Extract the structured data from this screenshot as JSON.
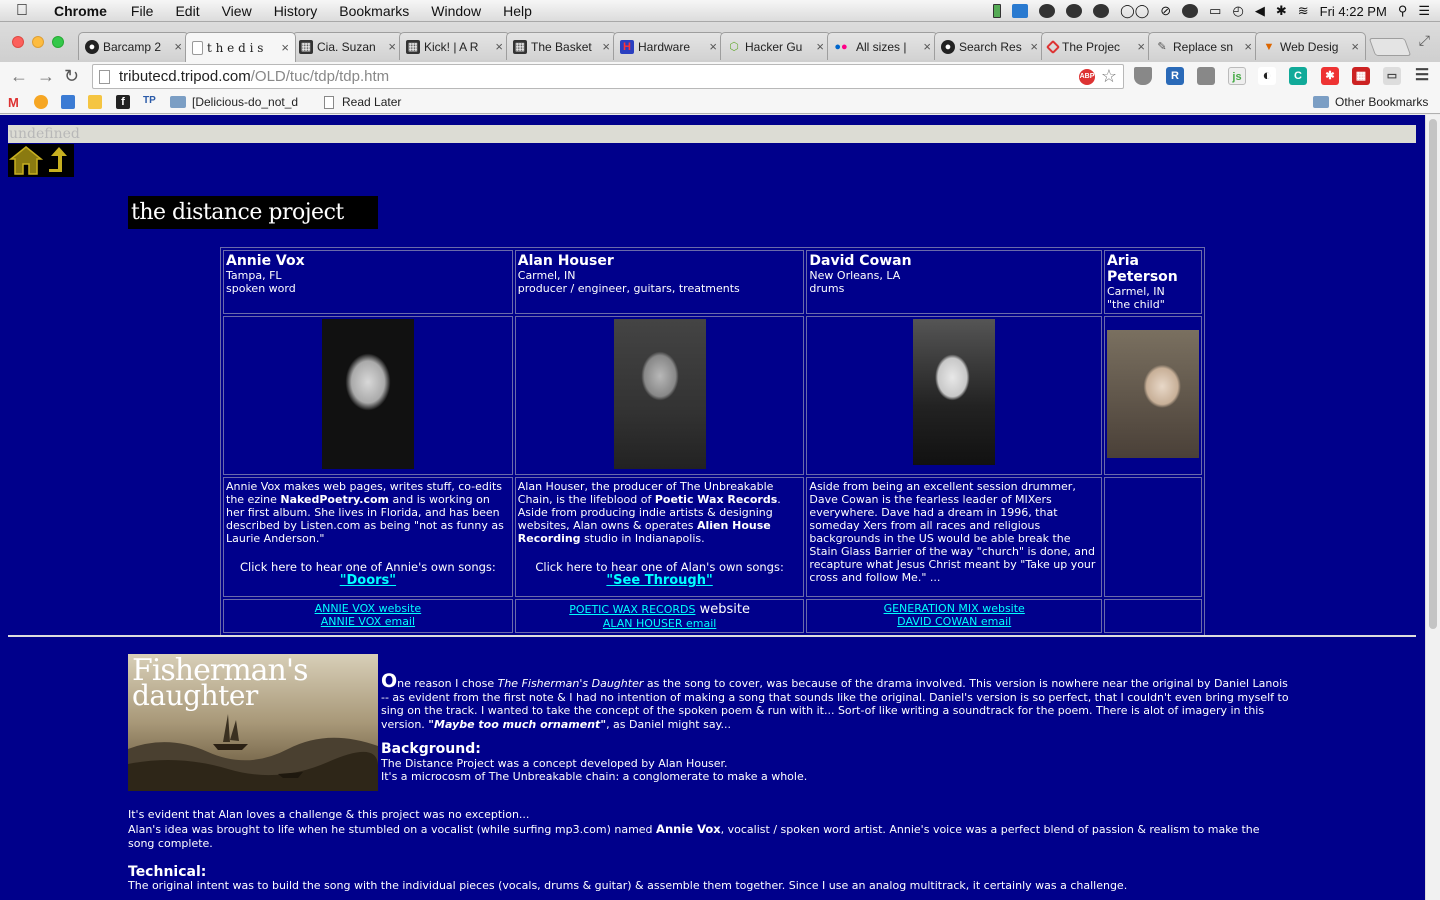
{
  "menubar": {
    "app": "Chrome",
    "items": [
      "File",
      "Edit",
      "View",
      "History",
      "Bookmarks",
      "Window",
      "Help"
    ],
    "clock": "Fri 4:22 PM"
  },
  "tabs": [
    {
      "title": "Barcamp 2",
      "active": false
    },
    {
      "title": "t h e   d i s",
      "active": true
    },
    {
      "title": "Cia. Suzan",
      "active": false
    },
    {
      "title": "Kick! | A R",
      "active": false
    },
    {
      "title": "The Basket",
      "active": false
    },
    {
      "title": "Hardware",
      "active": false
    },
    {
      "title": "Hacker Gu",
      "active": false
    },
    {
      "title": "All sizes |",
      "active": false
    },
    {
      "title": "Search Res",
      "active": false
    },
    {
      "title": "The Projec",
      "active": false
    },
    {
      "title": "Replace sn",
      "active": false
    },
    {
      "title": "Web Desig",
      "active": false
    }
  ],
  "toolbar": {
    "url_host": "tributecd.tripod.com",
    "url_path": "/OLD/tuc/tdp/tdp.htm"
  },
  "bookmarks": {
    "folder1": "[Delicious-do_not_d",
    "read_later": "Read Later",
    "other": "Other Bookmarks"
  },
  "page": {
    "undefined_text": "undefined",
    "title": "the distance project",
    "members": [
      {
        "name": "Annie Vox",
        "location": "Tampa, FL",
        "role": "spoken word",
        "bio_parts": [
          "Annie Vox makes web pages, writes stuff, co-edits the ezine ",
          "NakedPoetry.com",
          " and is working on her first album.  She lives in Florida, and has been described by Listen.com as being \"not as funny as Laurie Anderson.\""
        ],
        "click_text": "Click here to hear one of Annie's own songs:",
        "song": "\"Doors\"",
        "link1": "ANNIE VOX website",
        "link2": "ANNIE VOX email"
      },
      {
        "name": "Alan Houser",
        "location": "Carmel, IN",
        "role": "producer / engineer, guitars, treatments",
        "bio_parts": [
          "Alan Houser, the producer of The Unbreakable Chain, is the lifeblood of ",
          "Poetic Wax Records",
          ". Aside from producing indie artists & designing websites, Alan owns & operates ",
          "Alien House Recording",
          " studio in Indianapolis."
        ],
        "click_text": "Click here to hear one of Alan's own songs:",
        "song": "\"See Through\"",
        "link1": "POETIC WAX RECORDS",
        "link1_suffix": " website",
        "link2": "ALAN HOUSER email"
      },
      {
        "name": "David Cowan",
        "location": "New Orleans, LA",
        "role": "drums",
        "bio": "Aside from being an excellent session drummer, Dave Cowan is the fearless leader of MIXers everywhere.  Dave had a dream in 1996, that someday Xers from all races and religious backgrounds in the US would be able break the Stain Glass Barrier of the way \"church\" is done, and recapture what Jesus Christ meant by \"Take up your cross and follow Me.\" ...",
        "link1": "GENERATION MIX website",
        "link2": "DAVID COWAN email"
      },
      {
        "name": "Aria Peterson",
        "location": "Carmel, IN",
        "role": "\"the child\""
      }
    ],
    "fd_logo_line1": "Fisherman's",
    "fd_logo_line2": "daughter",
    "intro_dropcap": "O",
    "intro_parts": [
      "ne reason I chose ",
      "The Fisherman's Daughter",
      " as the song to cover, was because of the drama involved.  This version is nowhere near the original by Daniel Lanois -- as evident from the first note & I had no intention of making a song that sounds like the original.  Daniel's version is so perfect, that I couldn't even bring myself to sing on the track.  I wanted to take the concept of the spoken poem & run with it...  Sort-of like writing a soundtrack for the poem.  There is alot of imagery in this version.  ",
      "\"Maybe too much ornament\"",
      ", as Daniel might say..."
    ],
    "background_head": "Background:",
    "background_line1": "The Distance Project was a concept developed by Alan Houser.",
    "background_line2": "It's a microcosm of The Unbreakable chain: a conglomerate to make a whole.",
    "challenge_line": "It's evident that Alan loves a challenge & this project was no exception...",
    "idea_parts": [
      "Alan's idea was brought to life when he stumbled on a vocalist (while surfing mp3.com) named ",
      "Annie Vox",
      ", vocalist / spoken word artist.  Annie's voice was a perfect blend of passion & realism to make the song complete."
    ],
    "technical_head": "Technical:",
    "technical_line": "The original intent was to build the song with the individual pieces (vocals, drums & guitar) & assemble them together.  Since I use an analog multitrack, it certainly was a challenge."
  }
}
